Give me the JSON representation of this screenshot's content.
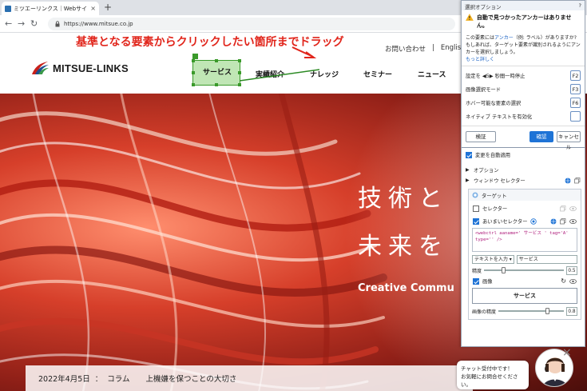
{
  "browser": {
    "tab_title": "ミツエーリンクス｜Webサイト構築・運",
    "tab_close": "×",
    "new_tab": "+",
    "url": "https://www.mitsue.co.jp"
  },
  "annotation": {
    "text": "基準となる要素からクリックしたい箇所までドラッグ"
  },
  "site": {
    "logo_text": "MITSUE-LINKS",
    "top_links": [
      "お問い合わせ",
      "|",
      "English"
    ],
    "menu": [
      "サービス",
      "実績紹介",
      "ナレッジ",
      "セミナー",
      "ニュース"
    ],
    "hero_line1": "技術と",
    "hero_line2": "未来を",
    "hero_line3": "Creative Commu",
    "news_date": "2022年4月5日",
    "news_sep": "：",
    "news_category": "コラム",
    "news_title": "上機嫌を保つことの大切さ"
  },
  "chat": {
    "line1": "チャット受付中です！",
    "line2": "お気軽にお問合せください。",
    "close": "×"
  },
  "panel": {
    "title": "選択オプション",
    "help": "?",
    "warning_title": "自動で見つかったアンカーはありません。",
    "body_pre": "この要素には",
    "body_anchor": "アンカー",
    "body_mid": "（例: ラベル）がありますか? もしあれば、ターゲット要素が識別されるようにアンカーを",
    "body_post": "選択しましょう。",
    "more_link": "もっと詳しく",
    "shortcuts": [
      {
        "label": "設定を ◀5▶ 秒間一時停止",
        "key": "F2"
      },
      {
        "label": "画像選択モード",
        "key": "F3"
      },
      {
        "label": "ホバー可能な要素の選択",
        "key": "F6"
      },
      {
        "label": "ネイティブ テキストを有効化",
        "key": ""
      }
    ],
    "validate": "検証",
    "confirm": "確認",
    "cancel": "キャンセル",
    "auto_apply": "変更を自動適用",
    "options": "オプション",
    "window_selector": "ウィンドウ セレクター",
    "target": "ターゲット",
    "selector": "セレクター",
    "fuzzy_selector": "あいまいセレクター",
    "code_line1": "<webctrl aaname=' サービス ' tag='A'",
    "code_line2": "type='' />",
    "text_input_select": "テキストを入力",
    "text_input_value": "サービス",
    "accuracy_label": "精度",
    "accuracy_value": "0.5",
    "image_label": "画像",
    "image_button": "サービス",
    "image_accuracy_label": "画像の精度",
    "image_accuracy_value": "0.8"
  }
}
